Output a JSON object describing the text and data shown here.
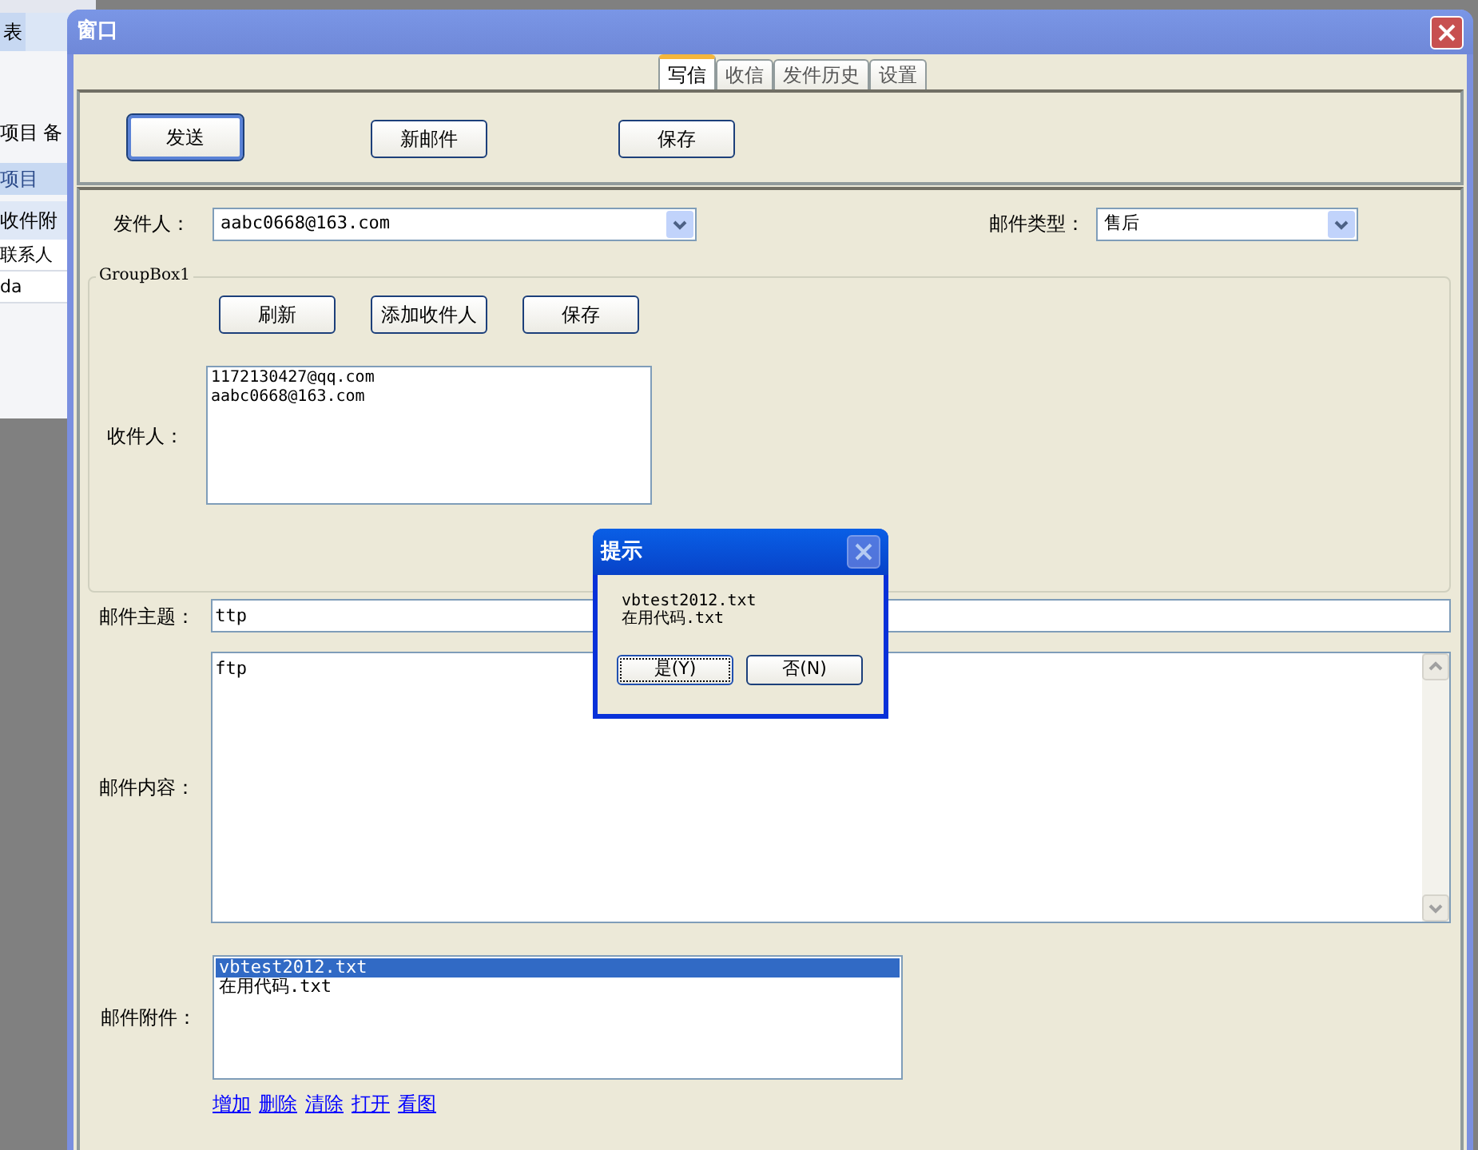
{
  "background_app": {
    "tabs": [
      {
        "label": "表",
        "selected": false
      }
    ],
    "toolbar_items": [
      "项目",
      "备"
    ],
    "section_title": "项目",
    "columns": [
      "收件附"
    ],
    "rows": [
      "联系人",
      "da"
    ]
  },
  "window": {
    "title": "窗口"
  },
  "tabs": [
    {
      "label": "写信",
      "selected": true
    },
    {
      "label": "收信",
      "selected": false
    },
    {
      "label": "发件历史",
      "selected": false
    },
    {
      "label": "设置",
      "selected": false
    }
  ],
  "toolbar_buttons": [
    {
      "label": "发送",
      "default": true
    },
    {
      "label": "新邮件",
      "default": false
    },
    {
      "label": "保存",
      "default": false
    }
  ],
  "sender": {
    "label": "发件人：",
    "value": "aabc0668@163.com"
  },
  "mail_type": {
    "label": "邮件类型：",
    "value": "售后"
  },
  "group_box": {
    "title": "GroupBox1",
    "buttons": [
      "刷新",
      "添加收件人",
      "保存"
    ],
    "recipients_label": "收件人：",
    "recipients": [
      "1172130427@qq.com",
      "aabc0668@163.com"
    ]
  },
  "subject": {
    "label": "邮件主题：",
    "value": "ttp"
  },
  "body": {
    "label": "邮件内容：",
    "value": "ftp"
  },
  "attachments": {
    "label": "邮件附件：",
    "items": [
      {
        "name": "vbtest2012.txt",
        "selected": true
      },
      {
        "name": "在用代码.txt",
        "selected": false
      }
    ],
    "links": [
      "增加",
      "删除",
      "清除",
      "打开",
      "看图"
    ]
  },
  "dialog": {
    "title": "提示",
    "lines": [
      "vbtest2012.txt",
      "在用代码.txt"
    ],
    "buttons": [
      {
        "label": "是(Y)",
        "focused": true
      },
      {
        "label": "否(N)",
        "focused": false
      }
    ]
  }
}
